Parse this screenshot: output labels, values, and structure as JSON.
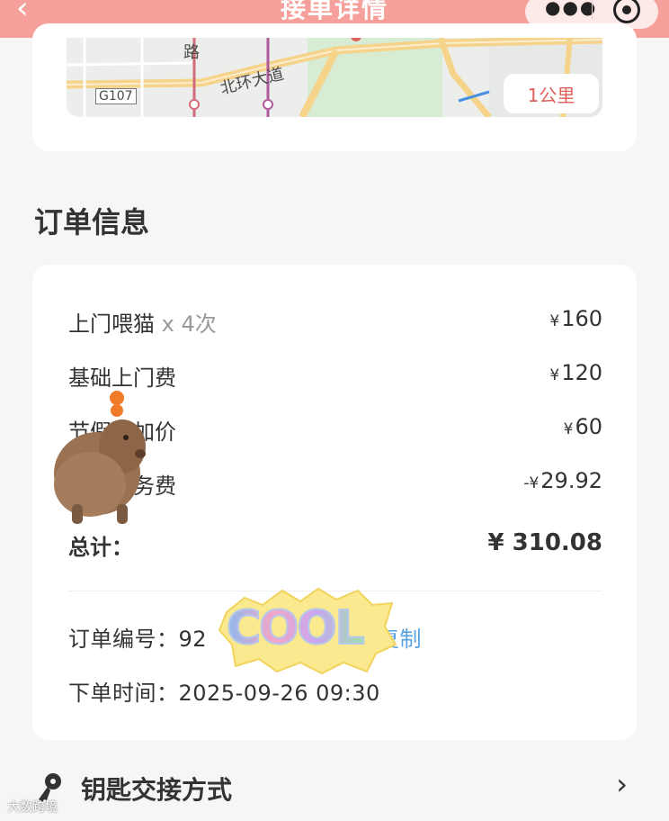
{
  "header": {
    "back_icon": "chevron-left-icon",
    "title": "接单详情",
    "more_icon": "more-dots-icon",
    "close_icon": "target-close-icon",
    "color": "#f5a09b"
  },
  "map": {
    "labels": {
      "road_1": "路",
      "road_2": "北环大道",
      "highway": "G107"
    },
    "distance": "1公里"
  },
  "order_info": {
    "title": "订单信息",
    "items": [
      {
        "label": "上门喂猫",
        "qty": "x 4次",
        "currency": "¥",
        "amount": "160"
      },
      {
        "label": "基础上门费",
        "currency": "¥",
        "amount": "120"
      },
      {
        "label": "节假日加价",
        "currency": "¥",
        "amount": "60"
      },
      {
        "label": "平台服务费",
        "currency": "-¥",
        "amount": "29.92"
      }
    ],
    "total_label": "总计：",
    "total_currency": "¥",
    "total_amount": "310.08",
    "order_no_label": "订单编号：",
    "order_no_value": "92",
    "copy_label": "复制",
    "order_time_label": "下单时间：",
    "order_time_value": "2025-09-26 09:30"
  },
  "stickers": {
    "capybara": "capybara-sticker",
    "cool": "COOL"
  },
  "key_handover": {
    "icon": "key-icon",
    "label": "钥匙交接方式",
    "chevron": "chevron-right-icon"
  },
  "watermark": "大数跨境",
  "colors": {
    "accent": "#f5a09b",
    "distance_text": "#e0605a",
    "link": "#5aa2e0"
  }
}
